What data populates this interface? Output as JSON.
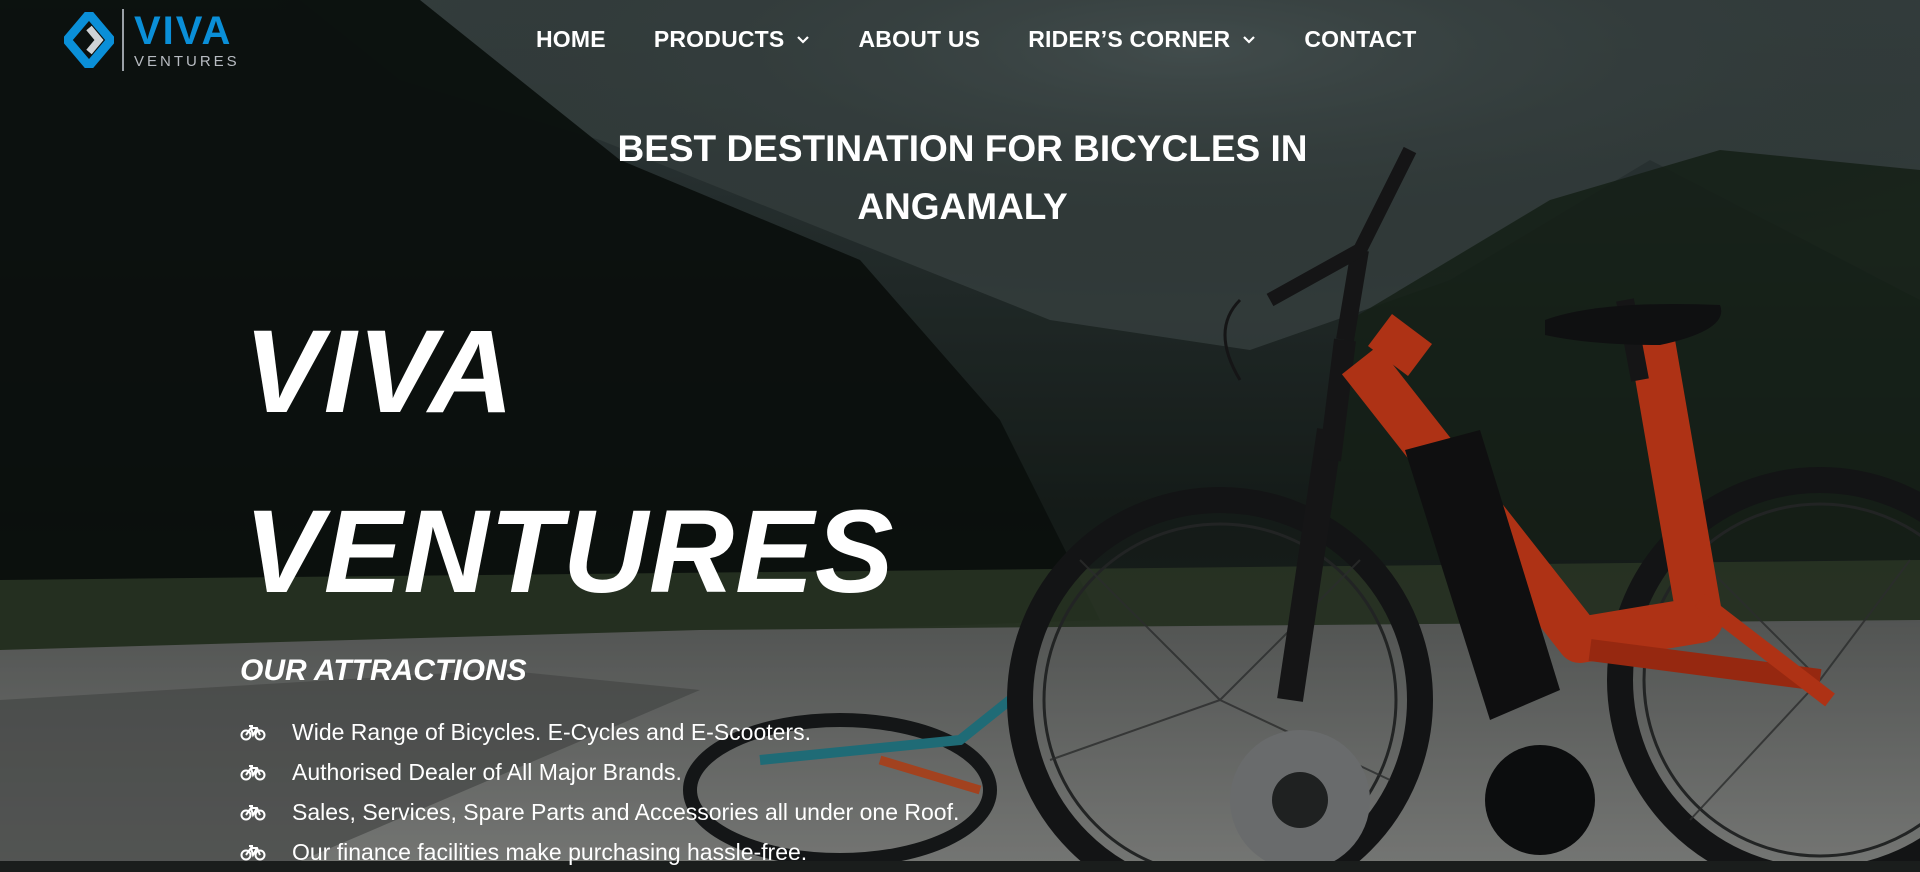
{
  "brand": {
    "name": "VIVA",
    "sub": "VENTURES",
    "logo_icon": "diamond-logo-icon",
    "color": "#0a8fd8"
  },
  "nav": {
    "items": [
      {
        "label": "HOME",
        "has_dropdown": false
      },
      {
        "label": "PRODUCTS",
        "has_dropdown": true
      },
      {
        "label": "ABOUT US",
        "has_dropdown": false
      },
      {
        "label": "RIDER’S CORNER",
        "has_dropdown": true
      },
      {
        "label": "CONTACT",
        "has_dropdown": false
      }
    ],
    "dropdown_icon": "chevron-down-icon"
  },
  "hero": {
    "tagline_line1": "BEST DESTINATION FOR BICYCLES IN",
    "tagline_line2": "ANGAMALY",
    "title_line1": "VIVA",
    "title_line2": "VENTURES",
    "background": "mountain-bicycle-photo"
  },
  "attractions": {
    "heading": "OUR ATTRACTIONS",
    "icon": "bicycle-icon",
    "items": [
      "Wide Range of Bicycles. E-Cycles and E-Scooters.",
      "Authorised Dealer of All Major Brands.",
      "Sales, Services, Spare Parts and Accessories all under one Roof.",
      "Our finance facilities make purchasing hassle-free."
    ]
  },
  "colors": {
    "bike_frame": "#e8431c",
    "text": "#ffffff"
  }
}
